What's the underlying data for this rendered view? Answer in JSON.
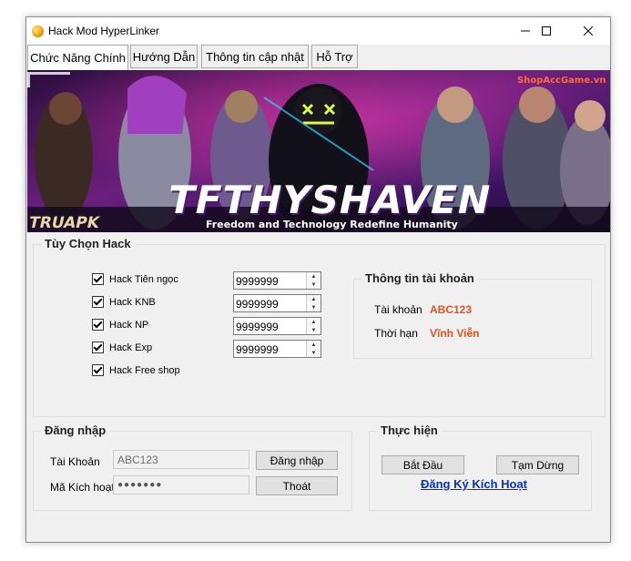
{
  "window": {
    "title": "Hack Mod HyperLinker"
  },
  "tabs": [
    "Chức Năng Chính",
    "Hướng Dẫn",
    "Thông tin cập nhật",
    "Hỗ Trợ"
  ],
  "banner": {
    "brand": "TFTHYSHAVEN",
    "slogan": "Freedom and Technology Redefine Humanity",
    "left_logo": "TRUAPK",
    "corner_logo": "ShopAccGame.vn"
  },
  "hack_options": {
    "title": "Tùy Chọn Hack",
    "items": [
      {
        "label": "Hack Tiên ngọc",
        "checked": true,
        "value": "9999999"
      },
      {
        "label": "Hack KNB",
        "checked": true,
        "value": "9999999"
      },
      {
        "label": "Hack NP",
        "checked": true,
        "value": "9999999"
      },
      {
        "label": "Hack Exp",
        "checked": true,
        "value": "9999999"
      },
      {
        "label": "Hack Free shop",
        "checked": true
      }
    ]
  },
  "account_info": {
    "title": "Thông tin tài khoản",
    "account_label": "Tài khoản",
    "account_value": "ABC123",
    "expiry_label": "Thời hạn",
    "expiry_value": "Vĩnh Viễn"
  },
  "login": {
    "title": "Đăng nhập",
    "account_label": "Tài Khoản",
    "account_value": "ABC123",
    "code_label": "Mã Kích hoạt",
    "code_value": "●●●●●●●",
    "login_button": "Đăng nhập",
    "exit_button": "Thoát"
  },
  "actions": {
    "title": "Thực hiện",
    "start_button": "Bắt Đầu",
    "pause_button": "Tạm Dừng",
    "register_link": "Đăng Ký Kích Hoạt"
  },
  "colors": {
    "accent_value": "#e8501e",
    "link": "#0033cc"
  }
}
